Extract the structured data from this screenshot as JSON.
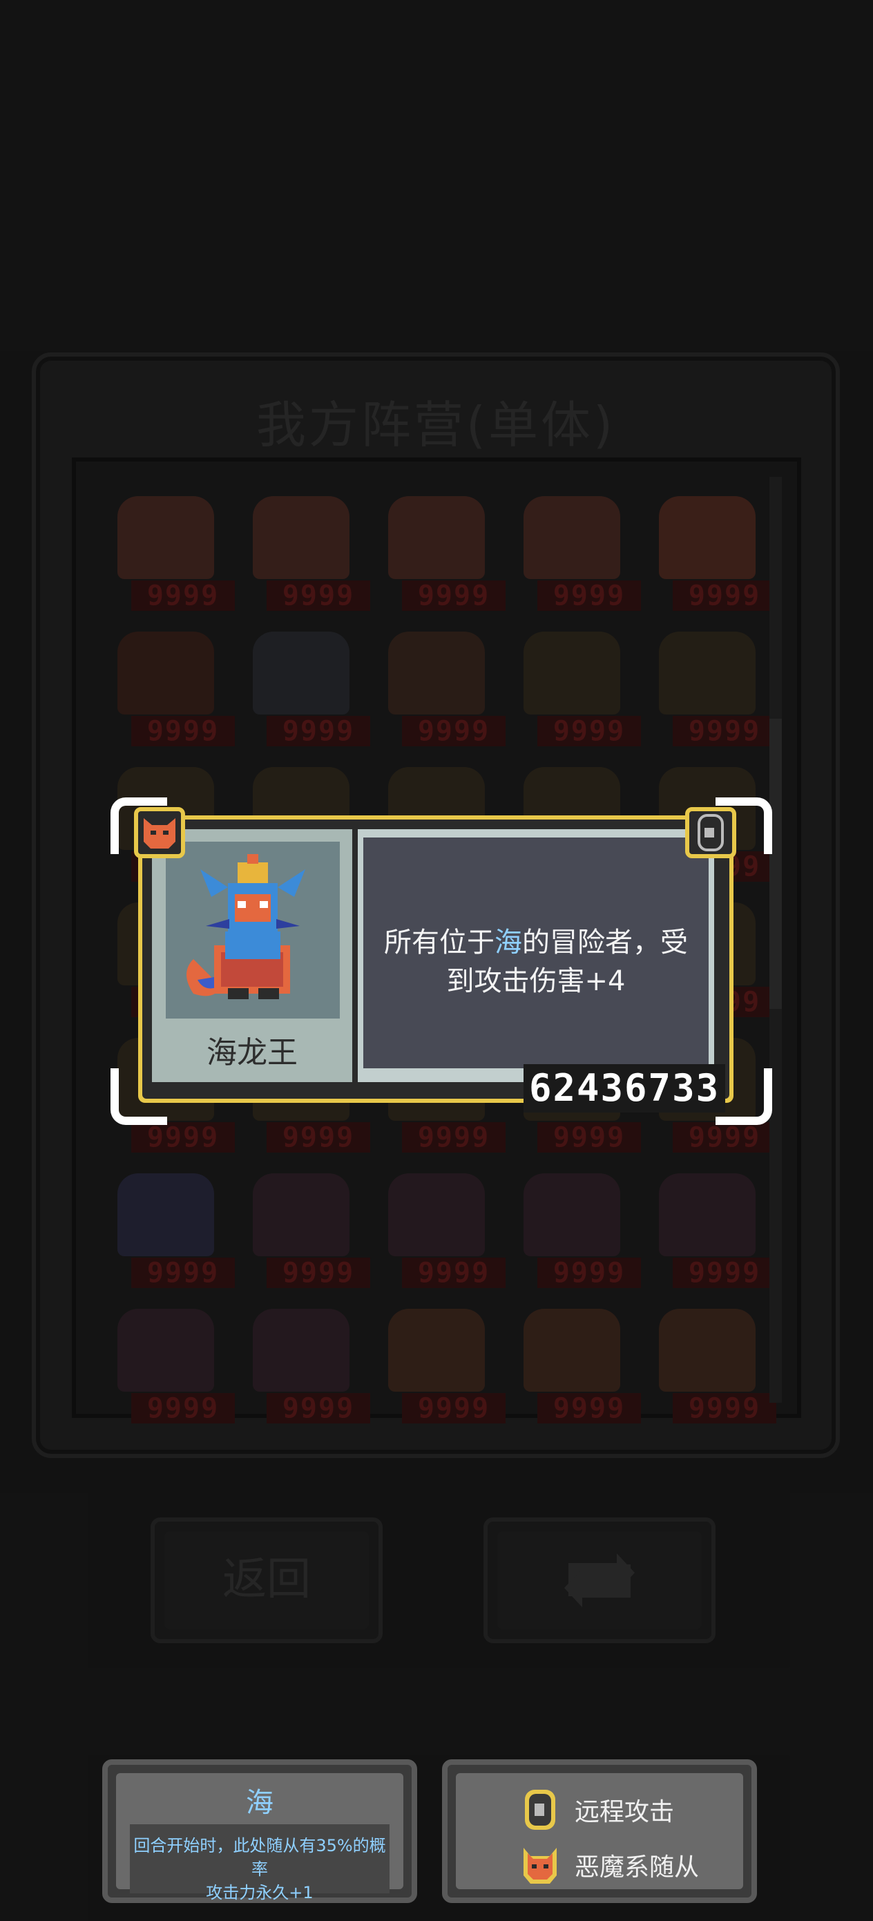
{
  "background": {
    "panel_title": "我方阵营(单体)",
    "unit_hp": "9999",
    "grid": [
      [
        "harpy",
        "harpy",
        "harpy",
        "harpy",
        "fox"
      ],
      [
        "staff",
        "dwarf",
        "warrior",
        "chest",
        "chest"
      ],
      [
        "chest",
        "chest",
        "chest",
        "chest",
        "chest"
      ],
      [
        "chest",
        "chest",
        "chest",
        "chest",
        "chest"
      ],
      [
        "chest",
        "chest",
        "chest",
        "chest",
        "chest"
      ],
      [
        "dragon",
        "demon",
        "demon",
        "demon",
        "demon"
      ],
      [
        "demon",
        "demon",
        "golem",
        "golem",
        "golem"
      ]
    ],
    "back_button": "返回",
    "refresh_icon": "refresh-icon"
  },
  "card": {
    "name": "海龙王",
    "desc_before": "所有位于",
    "desc_keyword": "海",
    "desc_after": "的冒险者，受到攻击伤害+4",
    "id": "62436733",
    "left_badge_icon": "demon-fox-icon",
    "right_badge_icon": "ranged-bow-icon"
  },
  "terrain": {
    "title": "海",
    "desc_line1": "回合开始时，此处随从有35%的概率",
    "desc_line2": "攻击力永久+1"
  },
  "tags": [
    {
      "icon": "ranged-bow-icon",
      "label": "远程攻击"
    },
    {
      "icon": "demon-fox-icon",
      "label": "恶魔系随从"
    }
  ],
  "colors": {
    "accent_gold": "#e8c84a",
    "keyword_blue": "#8fd0ff",
    "demon_orange": "#e4683f"
  }
}
